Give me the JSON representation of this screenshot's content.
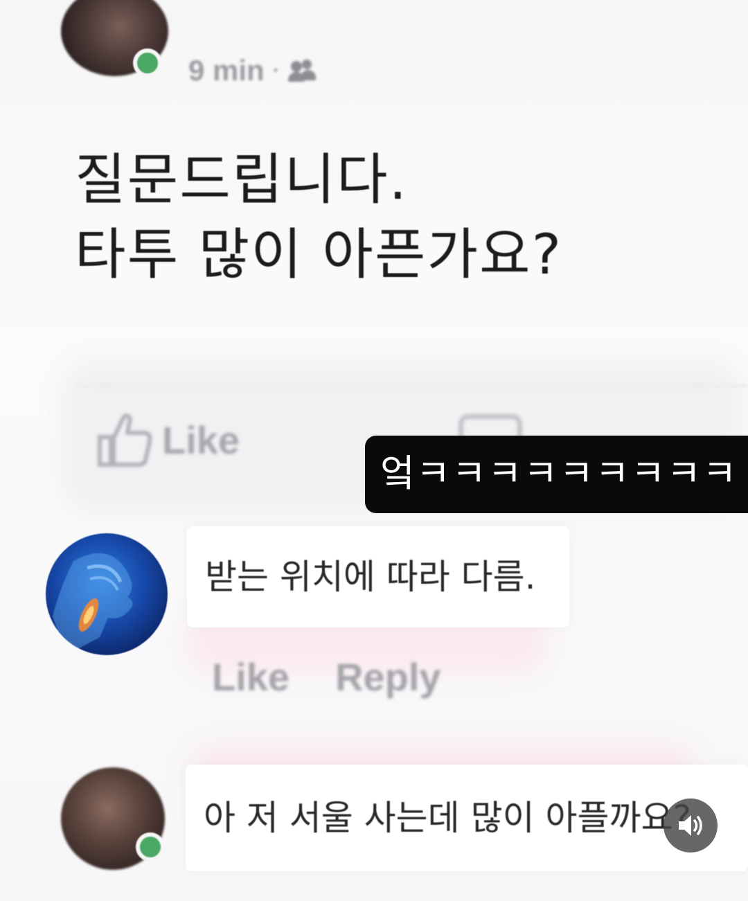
{
  "post": {
    "time": "9 min",
    "separator": "·",
    "audience_icon": "friends-icon",
    "lines": [
      "질문드립니다.",
      "타투 많이 아픈가요?"
    ]
  },
  "actions": {
    "like_label": "Like",
    "comment_icon": "comment-icon"
  },
  "sticker": {
    "text": "엌ㅋㅋㅋㅋㅋㅋㅋㅋㅋ"
  },
  "comments": [
    {
      "text": "받는 위치에 따라 다름.",
      "like_label": "Like",
      "reply_label": "Reply"
    },
    {
      "text": "아 저 서울 사는데 많이 아플까요?"
    }
  ],
  "overlay": {
    "audio_icon": "speaker-icon"
  },
  "colors": {
    "online": "#4aa764",
    "sticker_bg": "#0a0a0a",
    "sticker_text": "#ffffff"
  }
}
